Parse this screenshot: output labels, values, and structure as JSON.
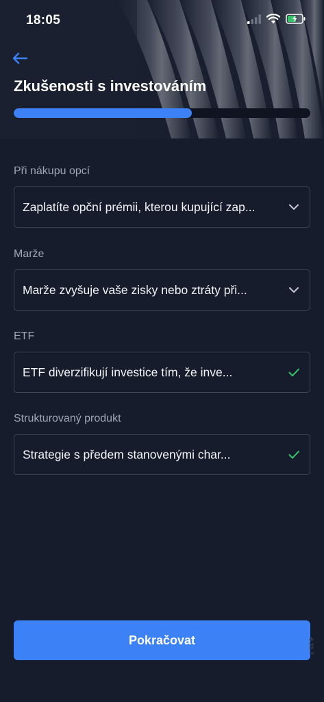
{
  "status_bar": {
    "time": "18:05"
  },
  "header": {
    "title": "Zkušenosti s investováním",
    "progress": 0.6
  },
  "fields": [
    {
      "label": "Při nákupu opcí",
      "value": "Zaplatíte opční prémii, kterou kupující zap...",
      "state": "dropdown"
    },
    {
      "label": "Marže",
      "value": "Marže zvyšuje vaše zisky nebo ztráty při...",
      "state": "dropdown"
    },
    {
      "label": "ETF",
      "value": "ETF diverzifikují investice tím, že inve...",
      "state": "completed"
    },
    {
      "label": "Strukturovaný produkt",
      "value": "Strategie s předem stanovenými char...",
      "state": "completed"
    }
  ],
  "footer": {
    "continue_label": "Pokračovat",
    "version": "6.21.7"
  },
  "colors": {
    "accent": "#3c82f6",
    "background": "#161c2b",
    "success": "#36c26a"
  }
}
